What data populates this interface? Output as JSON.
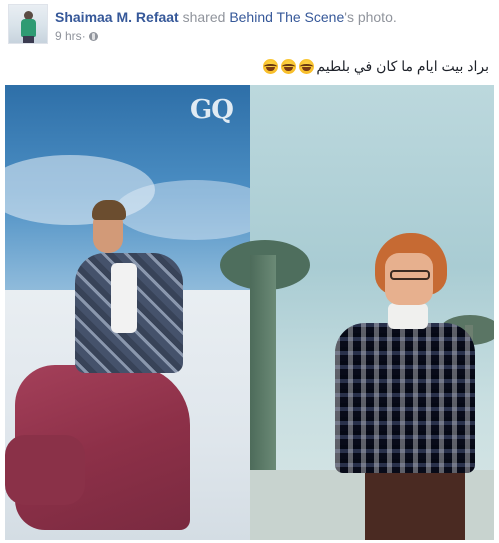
{
  "post": {
    "author": "Shaimaa M. Refaat",
    "action": " shared ",
    "page_name": "Behind The Scene",
    "suffix": "'s photo.",
    "time": "9 hrs",
    "separator": " · ",
    "privacy_icon": "globe-icon",
    "caption": "براد بيت ايام ما كان في بلطيم",
    "caption_emoji": [
      "joy-emoji",
      "joy-emoji",
      "joy-emoji"
    ]
  },
  "photo": {
    "watermark": "GQ"
  },
  "colors": {
    "link": "#365899",
    "meta": "#90949c",
    "text": "#1d2129"
  }
}
